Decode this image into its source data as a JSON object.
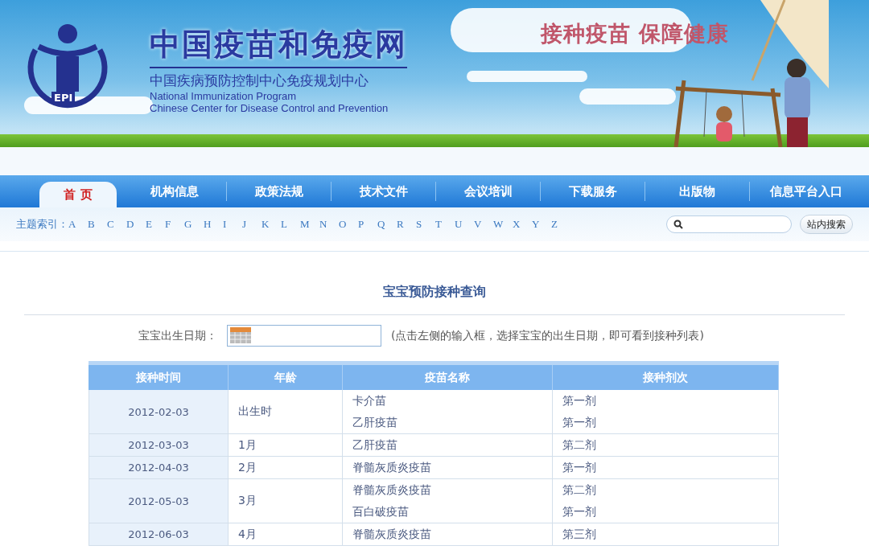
{
  "banner": {
    "logo_text": "EPI",
    "site_title": "中国疫苗和免疫网",
    "subtitle": "中国疾病预防控制中心免疫规划中心",
    "english_lines": [
      "National Immunization Program",
      "Chinese Center for Disease Control and Prevention"
    ],
    "slogan": "接种疫苗 保障健康"
  },
  "nav": [
    {
      "label": "首 页",
      "selected": true
    },
    {
      "label": "机构信息",
      "selected": false
    },
    {
      "label": "政策法规",
      "selected": false
    },
    {
      "label": "技术文件",
      "selected": false
    },
    {
      "label": "会议培训",
      "selected": false
    },
    {
      "label": "下载服务",
      "selected": false
    },
    {
      "label": "出版物",
      "selected": false
    },
    {
      "label": "信息平台入口",
      "selected": false
    }
  ],
  "index": {
    "label": "主题索引：",
    "letters": [
      "A",
      "B",
      "C",
      "D",
      "E",
      "F",
      "G",
      "H",
      "I",
      "J",
      "K",
      "L",
      "M",
      "N",
      "O",
      "P",
      "Q",
      "R",
      "S",
      "T",
      "U",
      "V",
      "W",
      "X",
      "Y",
      "Z"
    ]
  },
  "search": {
    "button": "站内搜索"
  },
  "query": {
    "title": "宝宝预防接种查询",
    "date_label": "宝宝出生日期：",
    "hint": "(点击左侧的输入框，选择宝宝的出生日期，即可看到接种列表)"
  },
  "table": {
    "columns": [
      "接种时间",
      "年龄",
      "疫苗名称",
      "接种剂次"
    ],
    "rows": [
      {
        "date": "2012-02-03",
        "age": "出生时",
        "items": [
          {
            "vaccine": "卡介苗",
            "dose": "第一剂"
          },
          {
            "vaccine": "乙肝疫苗",
            "dose": "第一剂"
          }
        ]
      },
      {
        "date": "2012-03-03",
        "age": "1月",
        "items": [
          {
            "vaccine": "乙肝疫苗",
            "dose": "第二剂"
          }
        ]
      },
      {
        "date": "2012-04-03",
        "age": "2月",
        "items": [
          {
            "vaccine": "脊髓灰质炎疫苗",
            "dose": "第一剂"
          }
        ]
      },
      {
        "date": "2012-05-03",
        "age": "3月",
        "items": [
          {
            "vaccine": "脊髓灰质炎疫苗",
            "dose": "第二剂"
          },
          {
            "vaccine": "百白破疫苗",
            "dose": "第一剂"
          }
        ]
      },
      {
        "date": "2012-06-03",
        "age": "4月",
        "items": [
          {
            "vaccine": "脊髓灰质炎疫苗",
            "dose": "第三剂"
          }
        ]
      }
    ]
  }
}
